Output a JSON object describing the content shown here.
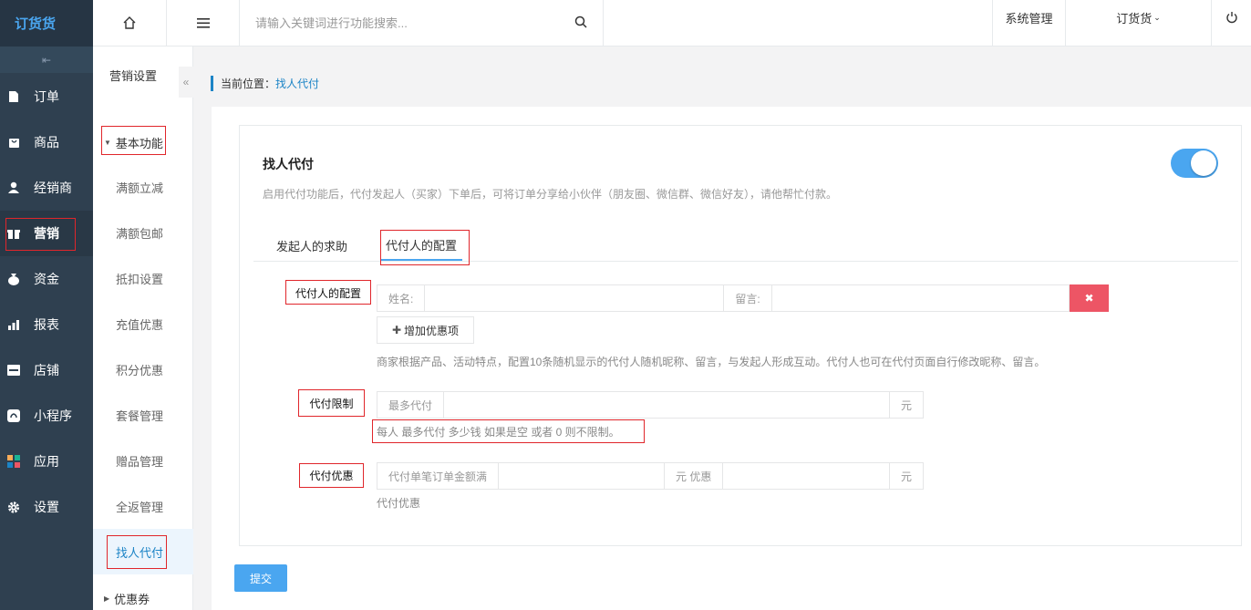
{
  "app": {
    "logo": "订货货"
  },
  "nav": [
    {
      "label": "订单",
      "icon": "document-icon"
    },
    {
      "label": "商品",
      "icon": "bag-icon"
    },
    {
      "label": "经销商",
      "icon": "user-icon"
    },
    {
      "label": "营销",
      "icon": "gift-icon"
    },
    {
      "label": "资金",
      "icon": "money-bag-icon"
    },
    {
      "label": "报表",
      "icon": "bar-chart-icon"
    },
    {
      "label": "店铺",
      "icon": "store-icon"
    },
    {
      "label": "小程序",
      "icon": "mini-program-icon"
    },
    {
      "label": "应用",
      "icon": "apps-icon"
    },
    {
      "label": "设置",
      "icon": "gear-icon"
    }
  ],
  "header": {
    "search_placeholder": "请输入关键词进行功能搜索...",
    "system": "系统管理",
    "account": "订货货"
  },
  "subnav": {
    "title": "营销设置",
    "group": "基本功能",
    "items": [
      "满额立减",
      "满额包邮",
      "抵扣设置",
      "充值优惠",
      "积分优惠",
      "套餐管理",
      "赠品管理",
      "全返管理",
      "找人代付"
    ],
    "group2": "优惠券"
  },
  "breadcrumb": {
    "prefix": "当前位置：",
    "current": "找人代付"
  },
  "card": {
    "title": "找人代付",
    "desc": "启用代付功能后，代付发起人（买家）下单后，可将订单分享给小伙伴（朋友圈、微信群、微信好友），请他帮忙付款。"
  },
  "tabs": [
    "发起人的求助",
    "代付人的配置"
  ],
  "config": {
    "label": "代付人的配置",
    "name_addon": "姓名:",
    "msg_addon": "留言:",
    "add_btn": "增加优惠项",
    "hint": "商家根据产品、活动特点，配置10条随机显示的代付人随机昵称、留言，与发起人形成互动。代付人也可在代付页面自行修改昵称、留言。"
  },
  "limit": {
    "label": "代付限制",
    "addon": "最多代付",
    "unit": "元",
    "hint": "每人 最多代付 多少钱 如果是空 或者 0 则不限制。"
  },
  "discount": {
    "label": "代付优惠",
    "addon1": "代付单笔订单金额满",
    "addon2": "元 优惠",
    "unit": "元",
    "hint": "代付优惠"
  },
  "submit": "提交"
}
